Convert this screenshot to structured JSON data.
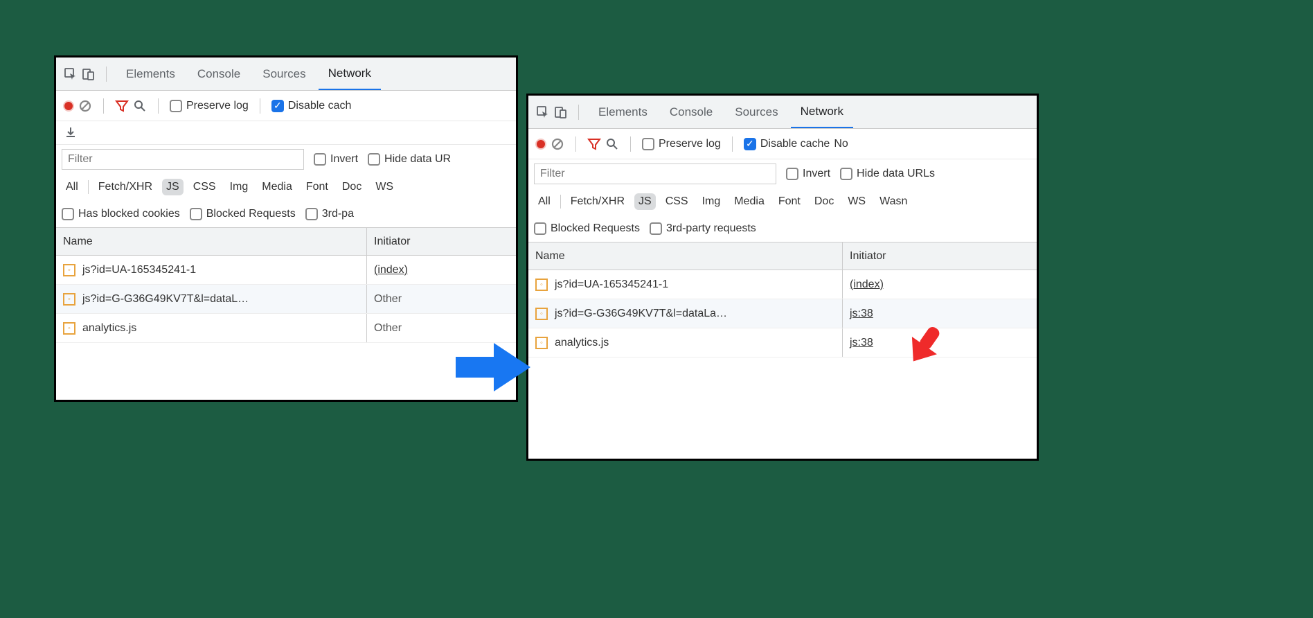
{
  "tabs": {
    "elements": "Elements",
    "console": "Console",
    "sources": "Sources",
    "network": "Network"
  },
  "toolbar": {
    "preserve": "Preserve log",
    "disable_left": "Disable cach",
    "disable_right": "Disable cache",
    "no": "No"
  },
  "filter": {
    "placeholder": "Filter",
    "invert": "Invert",
    "hide_left": "Hide data UR",
    "hide_right": "Hide data URLs"
  },
  "types": {
    "all": "All",
    "fetch": "Fetch/XHR",
    "js": "JS",
    "css": "CSS",
    "img": "Img",
    "media": "Media",
    "font": "Font",
    "doc": "Doc",
    "ws": "WS",
    "wasm": "Wasn"
  },
  "extra": {
    "cookies": "Has blocked cookies",
    "blocked": "Blocked Requests",
    "third_left": "3rd-pa",
    "third_right": "3rd-party requests"
  },
  "headers": {
    "name": "Name",
    "initiator": "Initiator"
  },
  "left_rows": [
    {
      "name": "js?id=UA-165345241-1",
      "init": "(index)",
      "link": true
    },
    {
      "name": "js?id=G-G36G49KV7T&l=dataL…",
      "init": "Other",
      "link": false
    },
    {
      "name": "analytics.js",
      "init": "Other",
      "link": false
    }
  ],
  "right_rows": [
    {
      "name": "js?id=UA-165345241-1",
      "init": "(index)",
      "link": true
    },
    {
      "name": "js?id=G-G36G49KV7T&l=dataLa…",
      "init": "js:38",
      "link": true
    },
    {
      "name": "analytics.js",
      "init": "js:38",
      "link": true
    }
  ]
}
